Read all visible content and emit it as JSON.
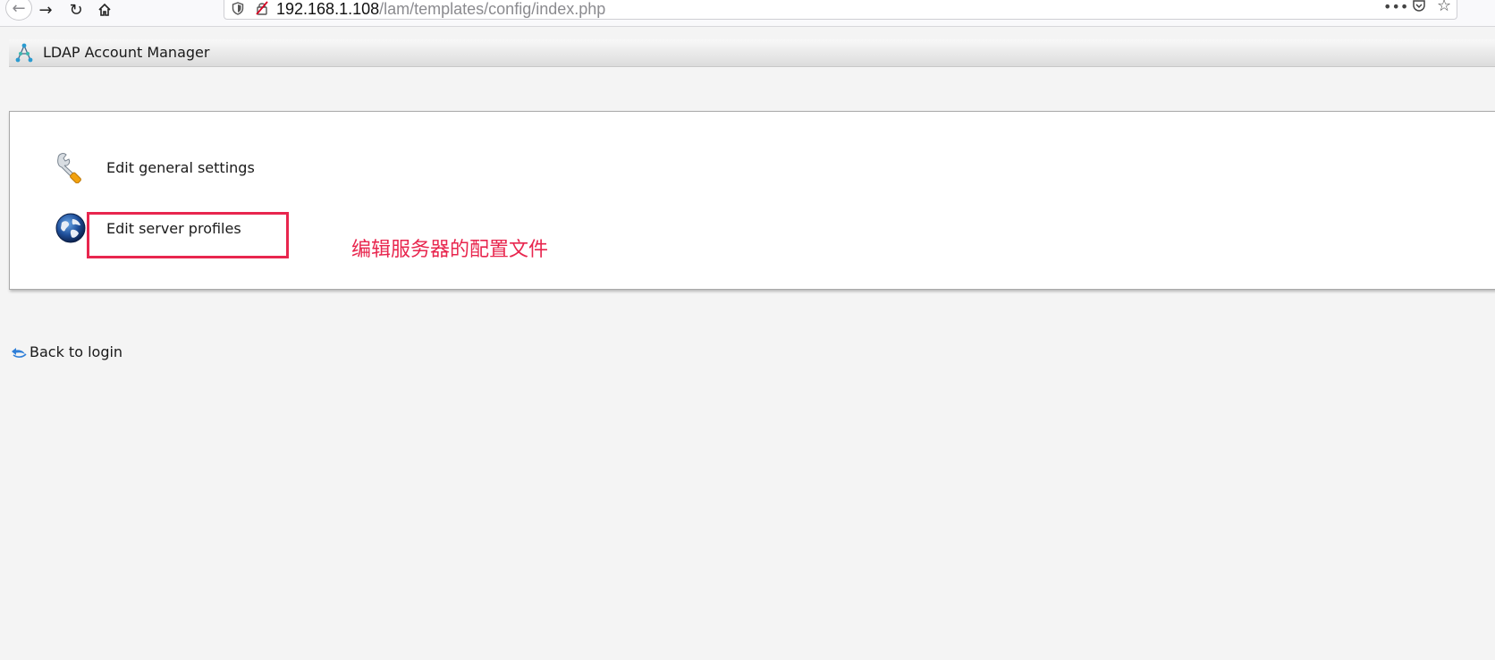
{
  "browser": {
    "url_host": "192.168.1.108",
    "url_path": "/lam/templates/config/index.php",
    "icons": {
      "back": "arrow-left-icon",
      "forward": "arrow-right-icon",
      "reload": "reload-icon",
      "home": "home-icon",
      "shield": "shield-icon",
      "insecure": "insecure-lock-icon",
      "more": "more-icon",
      "pocket": "pocket-icon",
      "bookmark": "star-icon"
    }
  },
  "header": {
    "title": "LDAP Account Manager",
    "logo_icon": "lam-logo-icon"
  },
  "menu": {
    "items": [
      {
        "label": "Edit general settings",
        "icon": "wrench-icon"
      },
      {
        "label": "Edit server profiles",
        "icon": "globe-icon"
      }
    ]
  },
  "annotation": {
    "text": "编辑服务器的配置文件",
    "color": "#e8264e"
  },
  "footer": {
    "back_label": "Back to login",
    "back_icon": "back-arrow-icon"
  }
}
